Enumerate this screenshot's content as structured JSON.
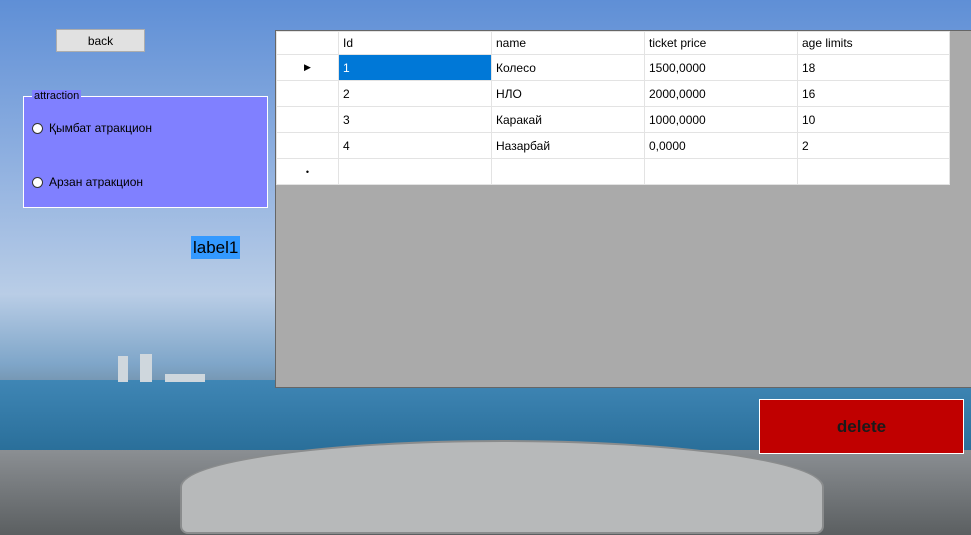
{
  "back_button": {
    "label": "back"
  },
  "attraction_group": {
    "title": "attraction",
    "options": [
      {
        "label": "Қымбат атракцион",
        "checked": false
      },
      {
        "label": "Арзан атракцион",
        "checked": false
      }
    ]
  },
  "label1": "label1",
  "grid": {
    "columns": [
      "Id",
      "name",
      "ticket price",
      "age limits"
    ],
    "rows": [
      [
        "1",
        "Колесо",
        "1500,0000",
        "18"
      ],
      [
        "2",
        "НЛО",
        "2000,0000",
        "16"
      ],
      [
        "3",
        "Каракай",
        "1000,0000",
        "10"
      ],
      [
        "4",
        "Назарбай",
        "0,0000",
        "2"
      ]
    ],
    "current_row_marker": "▶",
    "new_row_marker": "•",
    "selected_color": "#0078d7"
  },
  "delete_button": {
    "label": "delete",
    "color": "#c00000"
  }
}
